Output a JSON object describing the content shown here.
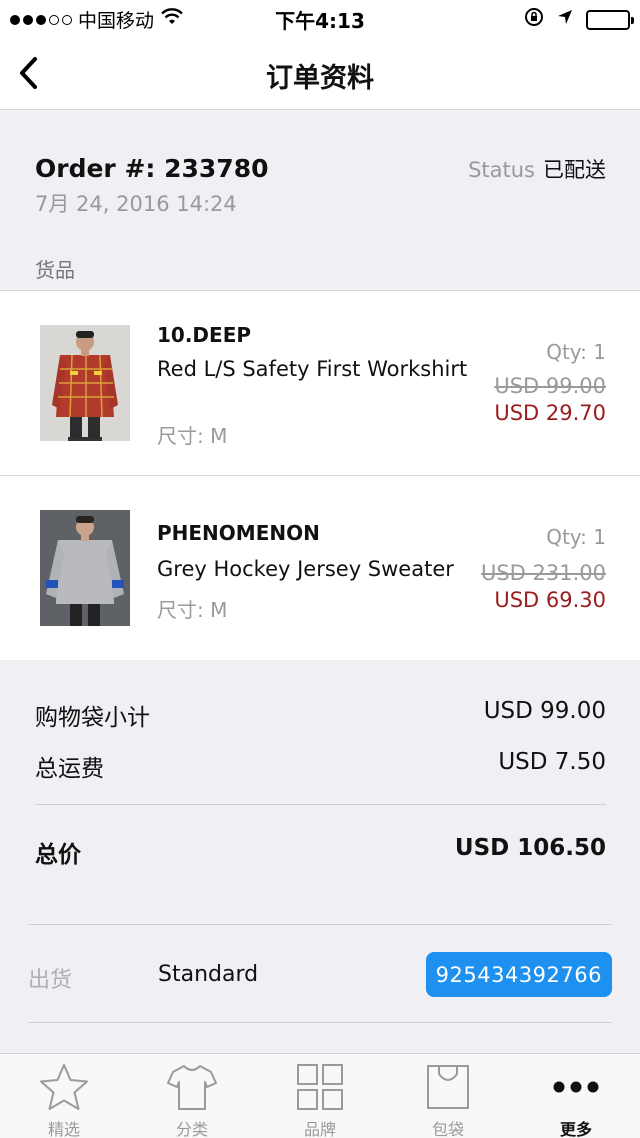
{
  "status_bar": {
    "carrier": "中国移动",
    "time": "下午4:13"
  },
  "nav": {
    "title": "订单资料",
    "back_icon": "chevron-left-icon"
  },
  "order": {
    "number_label": "Order #: 233780",
    "date": "7月 24, 2016 14:24",
    "status_label": "Status",
    "status_value": "已配送",
    "section_label": "货品"
  },
  "items": [
    {
      "brand": "10.DEEP",
      "name": "Red L/S Safety First Workshirt",
      "size": "尺寸: M",
      "qty": "Qty: 1",
      "original_price": "USD 99.00",
      "sale_price": "USD 29.70"
    },
    {
      "brand": "PHENOMENON",
      "name": "Grey Hockey Jersey Sweater",
      "size": "尺寸: M",
      "qty": "Qty: 1",
      "original_price": "USD 231.00",
      "sale_price": "USD 69.30"
    }
  ],
  "totals": {
    "subtotal_label": "购物袋小计",
    "subtotal_value": "USD 99.00",
    "shipping_label": "总运费",
    "shipping_value": "USD 7.50",
    "total_label": "总价",
    "total_value": "USD 106.50"
  },
  "shipment": {
    "label": "出货",
    "method": "Standard",
    "tracking_number": "925434392766"
  },
  "tabbar": {
    "tabs": [
      {
        "label": "精选",
        "icon": "star-icon"
      },
      {
        "label": "分类",
        "icon": "tshirt-icon"
      },
      {
        "label": "品牌",
        "icon": "grid-icon"
      },
      {
        "label": "包袋",
        "icon": "bag-icon"
      },
      {
        "label": "更多",
        "icon": "more-icon"
      }
    ],
    "active_index": 4
  },
  "colors": {
    "accent": "#1e90f0",
    "sale_price": "#9b1c1c",
    "muted_text": "#9a9a9a",
    "background": "#efeff4"
  }
}
